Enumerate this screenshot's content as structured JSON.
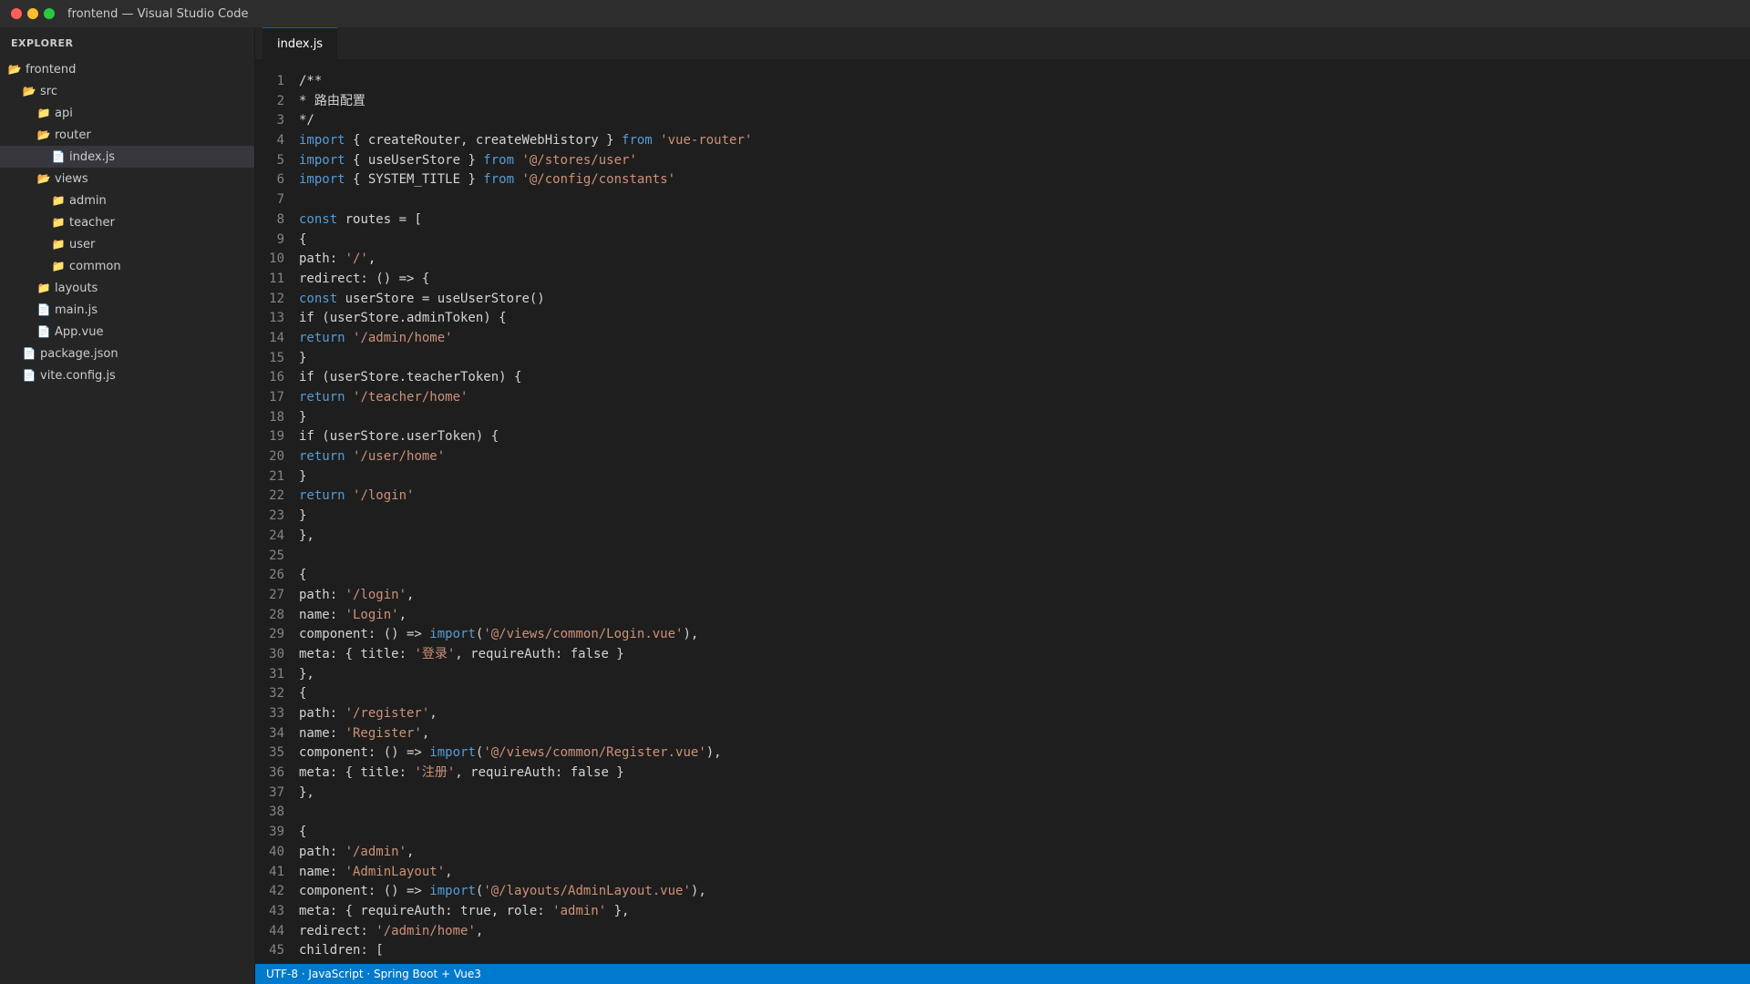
{
  "window": {
    "title": "frontend — Visual Studio Code"
  },
  "sidebar": {
    "header": "EXPLORER",
    "tree": [
      {
        "label": "frontend",
        "icon": "folder-open",
        "depth": 0
      },
      {
        "label": "src",
        "icon": "folder-open",
        "depth": 1
      },
      {
        "label": "api",
        "icon": "folder",
        "depth": 2
      },
      {
        "label": "router",
        "icon": "folder-open",
        "depth": 2
      },
      {
        "label": "index.js",
        "icon": "file",
        "depth": 3,
        "active": true
      },
      {
        "label": "views",
        "icon": "folder-open",
        "depth": 2
      },
      {
        "label": "admin",
        "icon": "folder",
        "depth": 3
      },
      {
        "label": "teacher",
        "icon": "folder",
        "depth": 3
      },
      {
        "label": "user",
        "icon": "folder",
        "depth": 3
      },
      {
        "label": "common",
        "icon": "folder",
        "depth": 3
      },
      {
        "label": "layouts",
        "icon": "folder",
        "depth": 2
      },
      {
        "label": "main.js",
        "icon": "file",
        "depth": 2
      },
      {
        "label": "App.vue",
        "icon": "file",
        "depth": 2
      },
      {
        "label": "package.json",
        "icon": "file",
        "depth": 1
      },
      {
        "label": "vite.config.js",
        "icon": "file",
        "depth": 1
      }
    ]
  },
  "tabs": [
    {
      "label": "index.js",
      "active": true
    }
  ],
  "editor": {
    "lines": [
      [
        [
          "",
          "/**"
        ]
      ],
      [
        [
          "",
          "* 路由配置"
        ]
      ],
      [
        [
          "",
          "*/"
        ]
      ],
      [
        [
          "k",
          "import"
        ],
        [
          "",
          " { createRouter, createWebHistory } "
        ],
        [
          "k",
          "from"
        ],
        [
          "",
          " "
        ],
        [
          "s",
          "'vue-router'"
        ]
      ],
      [
        [
          "k",
          "import"
        ],
        [
          "",
          " { useUserStore } "
        ],
        [
          "k",
          "from"
        ],
        [
          "",
          " "
        ],
        [
          "s",
          "'@/stores/user'"
        ]
      ],
      [
        [
          "k",
          "import"
        ],
        [
          "",
          " { SYSTEM_TITLE } "
        ],
        [
          "k",
          "from"
        ],
        [
          "",
          " "
        ],
        [
          "s",
          "'@/config/constants'"
        ]
      ],
      [],
      [
        [
          "k",
          "const"
        ],
        [
          "",
          " routes = ["
        ]
      ],
      [
        [
          "",
          "{"
        ]
      ],
      [
        [
          "",
          "path: "
        ],
        [
          "s",
          "'/'"
        ],
        [
          "",
          ","
        ]
      ],
      [
        [
          "",
          "redirect: () => {"
        ]
      ],
      [
        [
          "k",
          "const"
        ],
        [
          "",
          " userStore = useUserStore()"
        ]
      ],
      [
        [
          "",
          "if (userStore.adminToken) {"
        ]
      ],
      [
        [
          "k",
          "return"
        ],
        [
          "",
          " "
        ],
        [
          "s",
          "'/admin/home'"
        ]
      ],
      [
        [
          "",
          "}"
        ]
      ],
      [
        [
          "",
          "if (userStore.teacherToken) {"
        ]
      ],
      [
        [
          "k",
          "return"
        ],
        [
          "",
          " "
        ],
        [
          "s",
          "'/teacher/home'"
        ]
      ],
      [
        [
          "",
          "}"
        ]
      ],
      [
        [
          "",
          "if (userStore.userToken) {"
        ]
      ],
      [
        [
          "k",
          "return"
        ],
        [
          "",
          " "
        ],
        [
          "s",
          "'/user/home'"
        ]
      ],
      [
        [
          "",
          "}"
        ]
      ],
      [
        [
          "k",
          "return"
        ],
        [
          "",
          " "
        ],
        [
          "s",
          "'/login'"
        ]
      ],
      [
        [
          "",
          "}"
        ]
      ],
      [
        [
          "",
          "},"
        ]
      ],
      [],
      [
        [
          "",
          "{"
        ]
      ],
      [
        [
          "",
          "path: "
        ],
        [
          "s",
          "'/login'"
        ],
        [
          "",
          ","
        ]
      ],
      [
        [
          "",
          "name: "
        ],
        [
          "s",
          "'Login'"
        ],
        [
          "",
          ","
        ]
      ],
      [
        [
          "",
          "component: () => "
        ],
        [
          "k",
          "import"
        ],
        [
          "",
          "("
        ],
        [
          "s",
          "'@/views/common/Login.vue'"
        ],
        [
          "",
          "),"
        ]
      ],
      [
        [
          "",
          "meta: { title: "
        ],
        [
          "s",
          "'登录'"
        ],
        [
          "",
          ", requireAuth: false }"
        ]
      ],
      [
        [
          "",
          "},"
        ]
      ],
      [
        [
          "",
          "{"
        ]
      ],
      [
        [
          "",
          "path: "
        ],
        [
          "s",
          "'/register'"
        ],
        [
          "",
          ","
        ]
      ],
      [
        [
          "",
          "name: "
        ],
        [
          "s",
          "'Register'"
        ],
        [
          "",
          ","
        ]
      ],
      [
        [
          "",
          "component: () => "
        ],
        [
          "k",
          "import"
        ],
        [
          "",
          "("
        ],
        [
          "s",
          "'@/views/common/Register.vue'"
        ],
        [
          "",
          "),"
        ]
      ],
      [
        [
          "",
          "meta: { title: "
        ],
        [
          "s",
          "'注册'"
        ],
        [
          "",
          ", requireAuth: false }"
        ]
      ],
      [
        [
          "",
          "},"
        ]
      ],
      [],
      [
        [
          "",
          "{"
        ]
      ],
      [
        [
          "",
          "path: "
        ],
        [
          "s",
          "'/admin'"
        ],
        [
          "",
          ","
        ]
      ],
      [
        [
          "",
          "name: "
        ],
        [
          "s",
          "'AdminLayout'"
        ],
        [
          "",
          ","
        ]
      ],
      [
        [
          "",
          "component: () => "
        ],
        [
          "k",
          "import"
        ],
        [
          "",
          "("
        ],
        [
          "s",
          "'@/layouts/AdminLayout.vue'"
        ],
        [
          "",
          "),"
        ]
      ],
      [
        [
          "",
          "meta: { requireAuth: true, role: "
        ],
        [
          "s",
          "'admin'"
        ],
        [
          "",
          " },"
        ]
      ],
      [
        [
          "",
          "redirect: "
        ],
        [
          "s",
          "'/admin/home'"
        ],
        [
          "",
          ","
        ]
      ],
      [
        [
          "",
          "children: ["
        ]
      ]
    ]
  },
  "statusbar": {
    "text": "UTF-8 · JavaScript · Spring Boot + Vue3"
  },
  "colors": {
    "accent": "#007acc",
    "keyword": "#569cd6",
    "string": "#ce9178",
    "text": "#d4d4d4",
    "line_number": "#858585"
  }
}
